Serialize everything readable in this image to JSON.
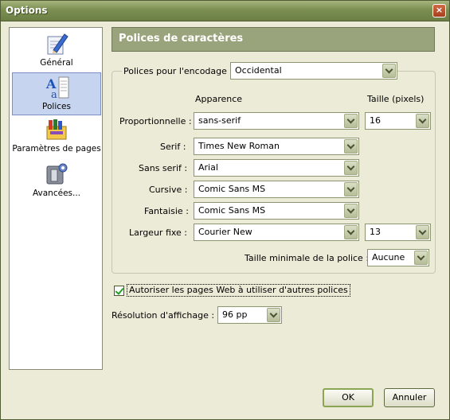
{
  "window": {
    "title": "Options",
    "close_glyph": "×"
  },
  "sidebar": {
    "items": [
      {
        "label": "Général",
        "icon": "pencil-paper-icon",
        "selected": false
      },
      {
        "label": "Polices",
        "icon": "fonts-icon",
        "selected": true
      },
      {
        "label": "Paramètres de pages",
        "icon": "page-colors-icon",
        "selected": false
      },
      {
        "label": "Avancées...",
        "icon": "advanced-tools-icon",
        "selected": false
      }
    ]
  },
  "header": {
    "title": "Polices de caractères"
  },
  "encoding": {
    "label": "Polices pour l'encodage :",
    "value": "Occidental"
  },
  "columns": {
    "appearance": "Apparence",
    "size": "Taille (pixels)"
  },
  "fonts": {
    "proportional": {
      "label": "Proportionnelle :",
      "value": "sans-serif",
      "size": "16"
    },
    "serif": {
      "label": "Serif :",
      "value": "Times New Roman"
    },
    "sans_serif": {
      "label": "Sans serif :",
      "value": "Arial"
    },
    "cursive": {
      "label": "Cursive :",
      "value": "Comic Sans MS"
    },
    "fantasy": {
      "label": "Fantaisie :",
      "value": "Comic Sans MS"
    },
    "monospace": {
      "label": "Largeur fixe :",
      "value": "Courier New",
      "size": "13"
    }
  },
  "min_size": {
    "label": "Taille minimale de la police :",
    "value": "Aucune"
  },
  "allow_pages": {
    "label": "Autoriser les pages Web à utiliser d'autres polices",
    "checked": true
  },
  "resolution": {
    "label": "Résolution d'affichage :",
    "value": "96 pp"
  },
  "buttons": {
    "ok": "OK",
    "cancel": "Annuler"
  },
  "colors": {
    "title_bar": "#7c8f52",
    "header_bg": "#9aa47c",
    "selection": "#c6d4f0",
    "dialog_bg": "#ecebd8"
  }
}
